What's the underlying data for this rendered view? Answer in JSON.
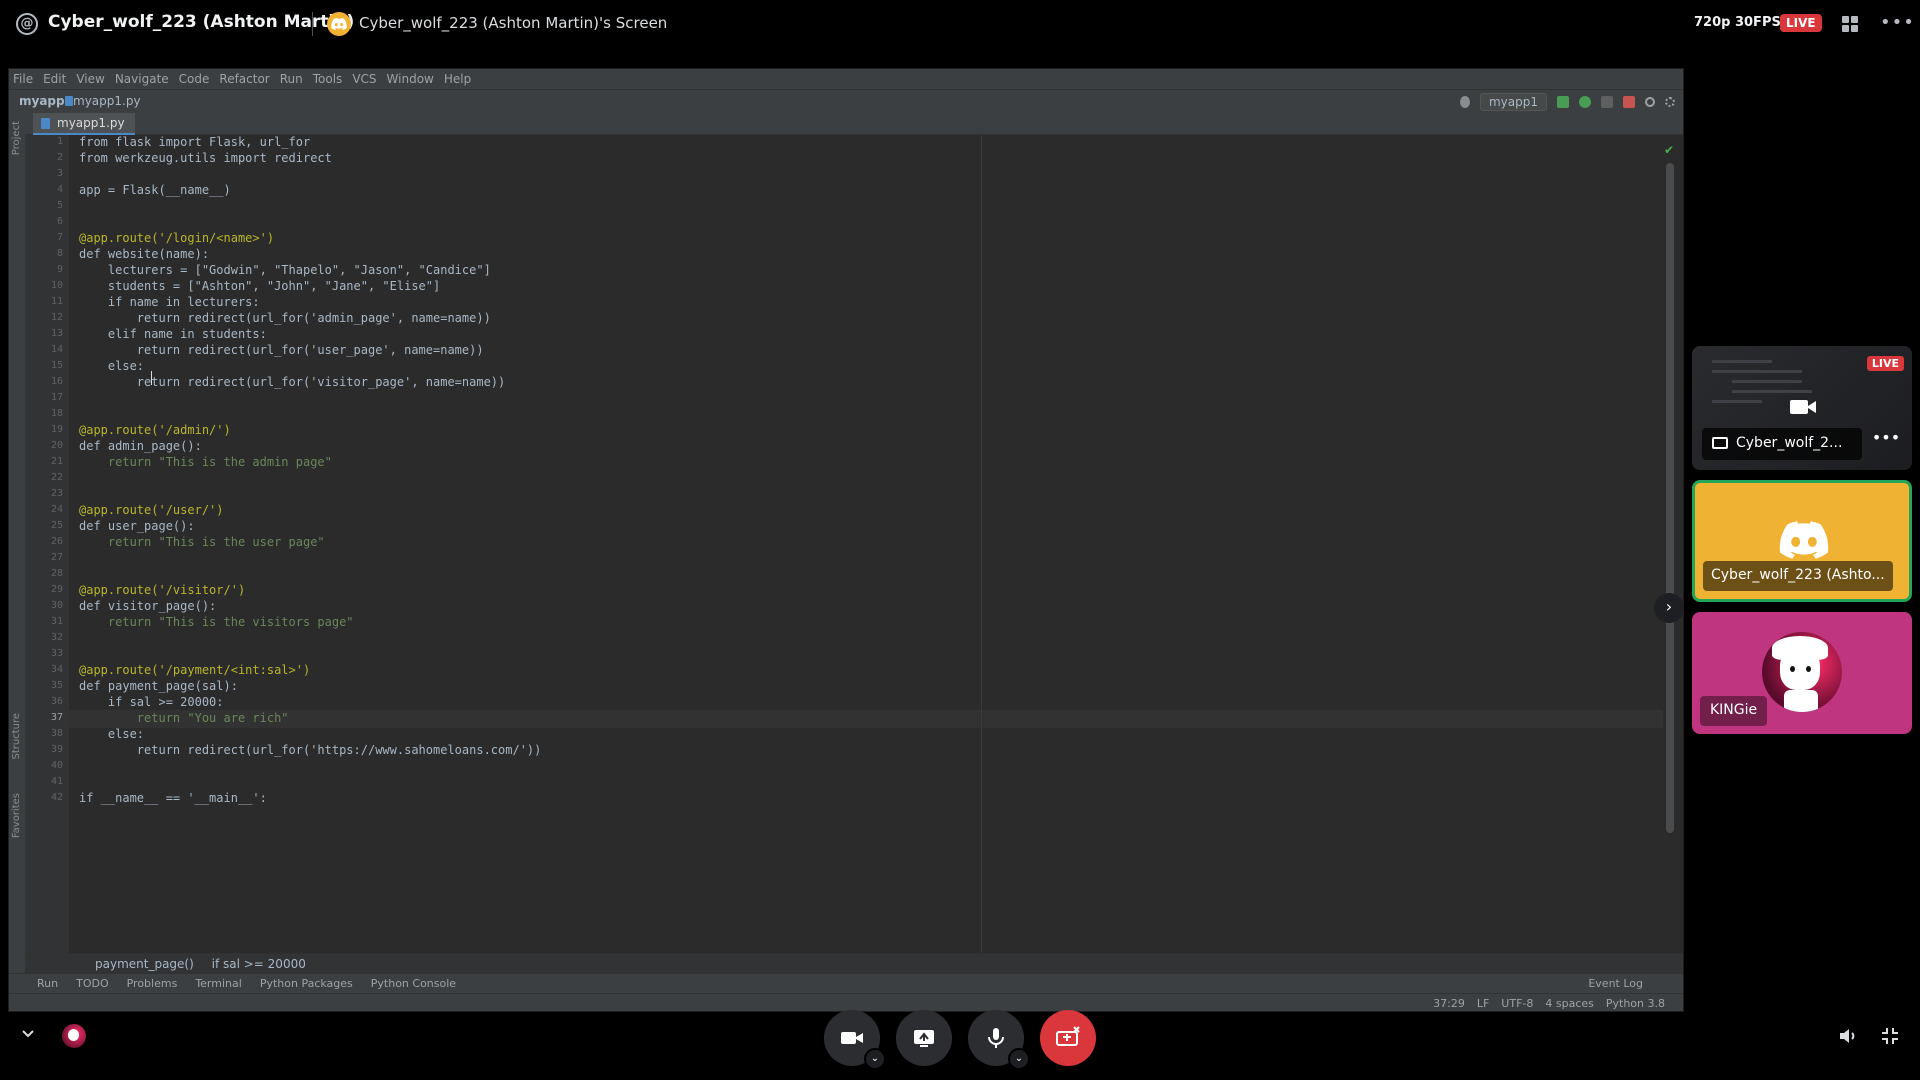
{
  "header": {
    "channel_title": "Cyber_wolf_223 (Ashton Martin)",
    "screen_title": "Cyber_wolf_223 (Ashton Martin)'s Screen",
    "quality": "720p 30FPS",
    "live": "LIVE"
  },
  "ide": {
    "menu": [
      "File",
      "Edit",
      "View",
      "Navigate",
      "Code",
      "Refactor",
      "Run",
      "Tools",
      "VCS",
      "Window",
      "Help"
    ],
    "project": "myapp",
    "file": "myapp1.py",
    "tab": "myapp1.py",
    "run_config": "myapp1",
    "left_tools": [
      "Project",
      "Structure",
      "Favorites"
    ],
    "breadcrumb": [
      "payment_page()",
      "if sal >= 20000"
    ],
    "tool_windows": [
      "Run",
      "TODO",
      "Problems",
      "Terminal",
      "Python Packages",
      "Python Console"
    ],
    "event_log": "Event Log",
    "status": [
      "37:29",
      "LF",
      "UTF-8",
      "4 spaces",
      "Python 3.8"
    ],
    "line_numbers": [
      "1",
      "2",
      "3",
      "4",
      "5",
      "6",
      "7",
      "8",
      "9",
      "10",
      "11",
      "12",
      "13",
      "14",
      "15",
      "16",
      "17",
      "18",
      "19",
      "20",
      "21",
      "22",
      "23",
      "24",
      "25",
      "26",
      "27",
      "28",
      "29",
      "30",
      "31",
      "32",
      "33",
      "34",
      "35",
      "36",
      "37",
      "38",
      "39",
      "40",
      "41",
      "42"
    ]
  },
  "code": {
    "l1": "from flask import Flask, url_for",
    "l2": "from werkzeug.utils import redirect",
    "l4": "app = Flask(__name__)",
    "l7": "@app.route('/login/<name>')",
    "l8": "def website(name):",
    "l9": "    lecturers = [\"Godwin\", \"Thapelo\", \"Jason\", \"Candice\"]",
    "l10": "    students = [\"Ashton\", \"John\", \"Jane\", \"Elise\"]",
    "l11": "    if name in lecturers:",
    "l12": "        return redirect(url_for('admin_page', name=name))",
    "l13": "    elif name in students:",
    "l14": "        return redirect(url_for('user_page', name=name))",
    "l15": "    else:",
    "l16": "        return redirect(url_for('visitor_page', name=name))",
    "l19": "@app.route('/admin/')",
    "l20": "def admin_page():",
    "l21": "    return \"This is the admin page\"",
    "l24": "@app.route('/user/')",
    "l25": "def user_page():",
    "l26": "    return \"This is the user page\"",
    "l29": "@app.route('/visitor/')",
    "l30": "def visitor_page():",
    "l31": "    return \"This is the visitors page\"",
    "l34": "@app.route('/payment/<int:sal>')",
    "l35": "def payment_page(sal):",
    "l36": "    if sal >= 20000:",
    "l37": "        return \"You are rich\"",
    "l38": "    else:",
    "l39": "        return redirect(url_for('https://www.sahomeloans.com/'))",
    "l42": "if __name__ == '__main__':"
  },
  "participants": {
    "stream_label": "Cyber_wolf_2...",
    "stream_live": "LIVE",
    "user_label": "Cyber_wolf_223 (Ashto...",
    "kingie_label": "KINGie"
  },
  "colors": {
    "live_red": "#da373c",
    "speaking_green": "#23a55a",
    "user_tile": "#f0b232",
    "kingie_tile": "#c0357f"
  },
  "icons": [
    "at-icon",
    "discord-icon",
    "grid-icon",
    "more-icon",
    "camera-icon",
    "screen-share-icon",
    "microphone-icon",
    "leave-stream-icon",
    "volume-icon",
    "exit-fullscreen-icon",
    "chevron-down-icon",
    "chevron-right-icon",
    "monitor-icon"
  ]
}
